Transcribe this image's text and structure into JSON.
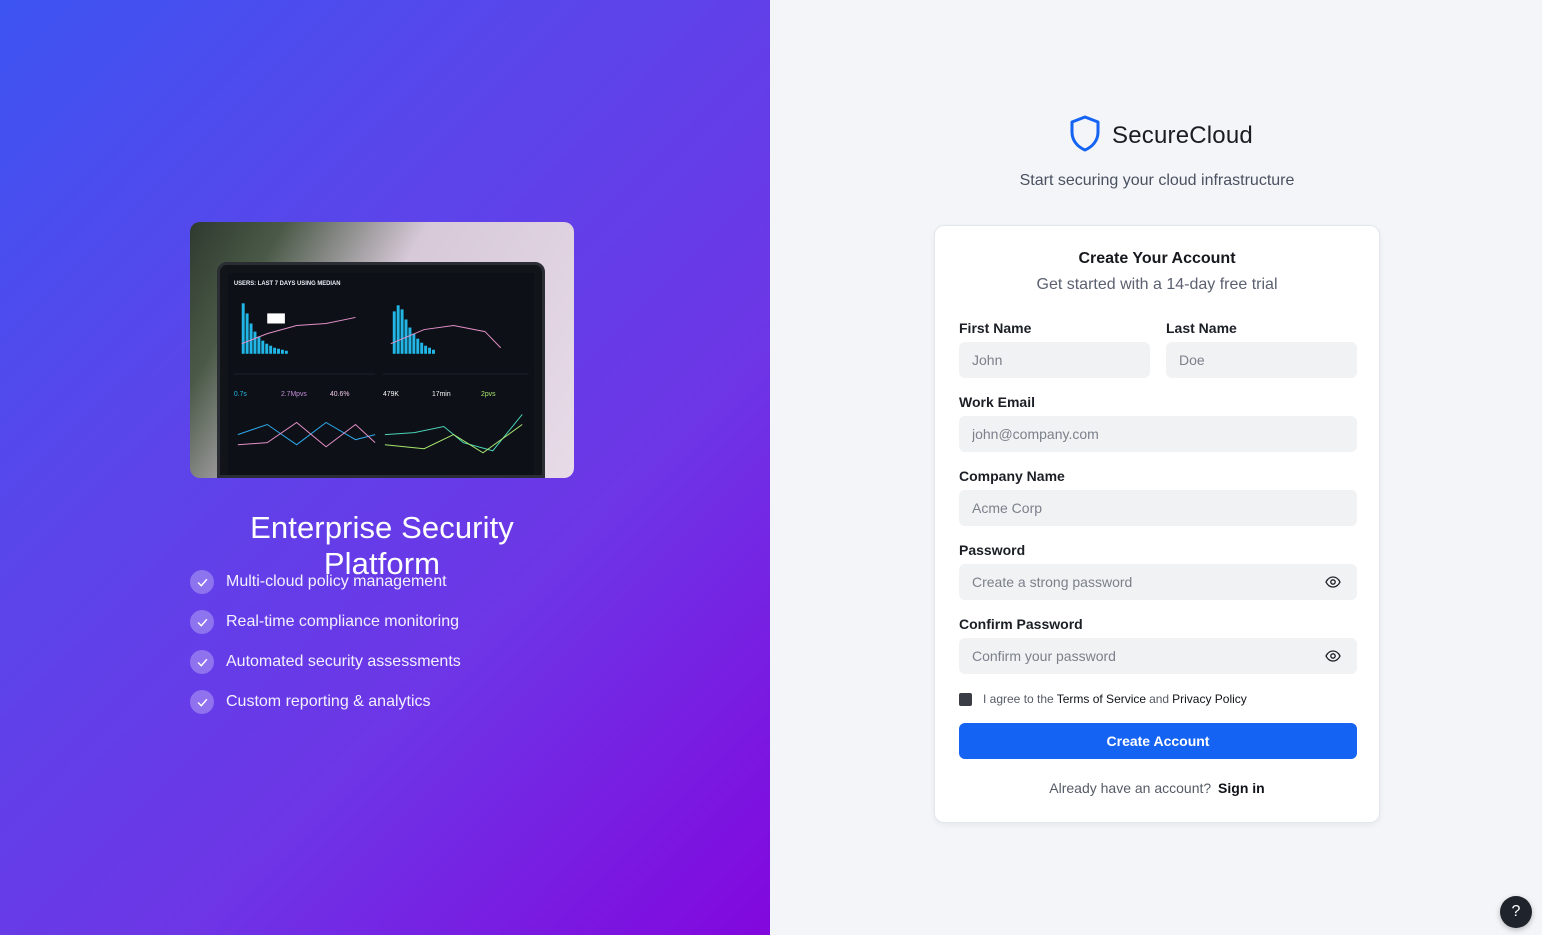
{
  "hero": {
    "image_alt": "Analytics dashboard on laptop",
    "screen_header": "USERS: LAST 7 DAYS USING MEDIAN",
    "title": "Enterprise Security Platform",
    "features": [
      {
        "label": "Multi-cloud policy management",
        "icon": "check-icon"
      },
      {
        "label": "Real-time compliance monitoring",
        "icon": "check-icon"
      },
      {
        "label": "Automated security assessments",
        "icon": "check-icon"
      },
      {
        "label": "Custom reporting & analytics",
        "icon": "check-icon"
      }
    ]
  },
  "brand": {
    "name": "SecureCloud",
    "icon": "shield-icon",
    "tagline": "Start securing your cloud infrastructure"
  },
  "form": {
    "title": "Create Your Account",
    "subtitle": "Get started with a 14-day free trial",
    "first_name": {
      "label": "First Name",
      "placeholder": "John",
      "value": ""
    },
    "last_name": {
      "label": "Last Name",
      "placeholder": "Doe",
      "value": ""
    },
    "email": {
      "label": "Work Email",
      "placeholder": "john@company.com",
      "value": ""
    },
    "company": {
      "label": "Company Name",
      "placeholder": "Acme Corp",
      "value": ""
    },
    "password": {
      "label": "Password",
      "placeholder": "Create a strong password",
      "value": "",
      "toggle_icon": "eye-icon"
    },
    "confirm": {
      "label": "Confirm Password",
      "placeholder": "Confirm your password",
      "value": "",
      "toggle_icon": "eye-icon"
    },
    "agree": {
      "prefix": "I agree to the",
      "terms": "Terms of Service",
      "and": "and",
      "privacy": "Privacy Policy"
    },
    "submit_label": "Create Account",
    "signin_prompt": "Already have an account?",
    "signin_link": "Sign in"
  },
  "help_label": "?",
  "colors": {
    "accent": "#1463f3",
    "gradient_start": "#3d54f2",
    "gradient_end": "#8207de"
  }
}
